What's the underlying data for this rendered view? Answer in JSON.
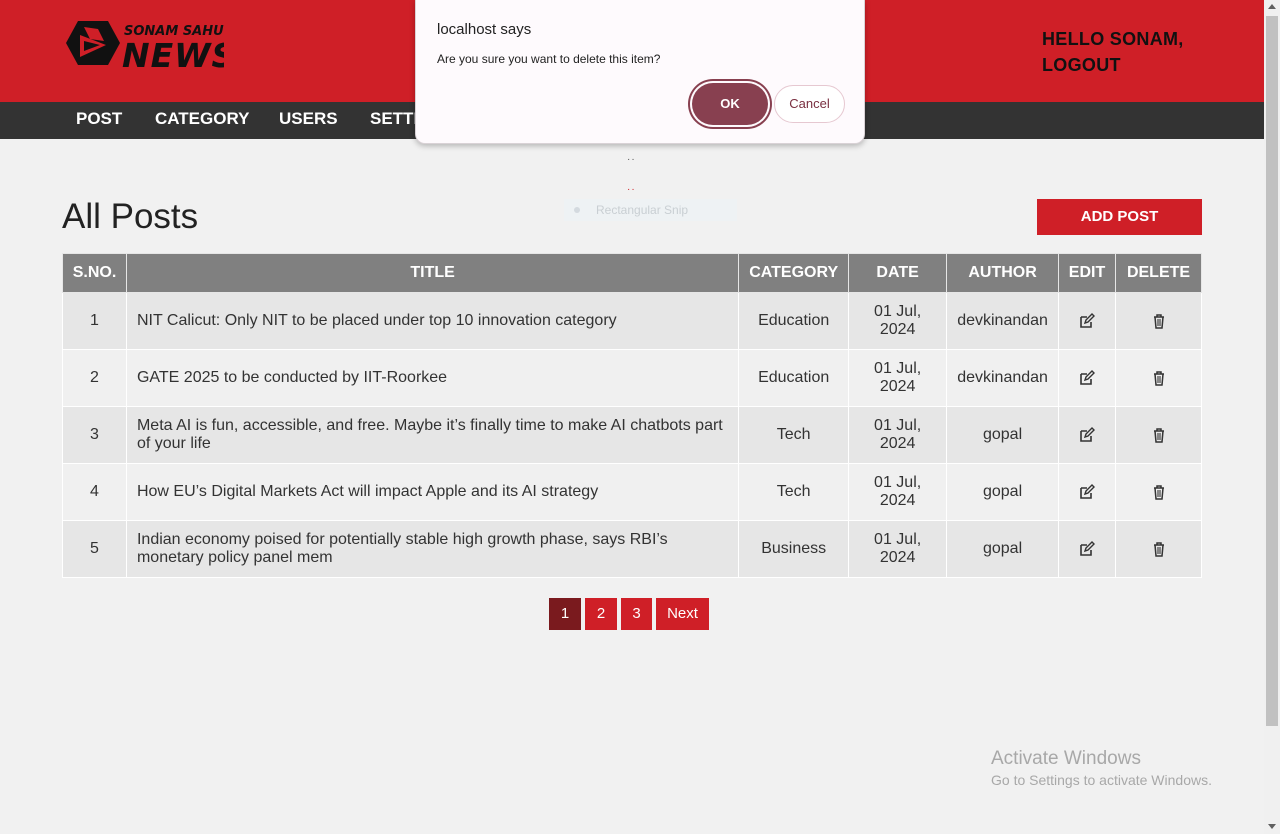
{
  "header": {
    "logo_small": "SONAM SAHU",
    "logo_big": "NEWS",
    "greeting": "HELLO SONAM,",
    "logout": "LOGOUT"
  },
  "nav": {
    "items": [
      "POST",
      "CATEGORY",
      "USERS",
      "SETTI"
    ]
  },
  "page": {
    "title": "All Posts",
    "add_button": "ADD POST"
  },
  "table": {
    "headers": [
      "S.NO.",
      "TITLE",
      "CATEGORY",
      "DATE",
      "AUTHOR",
      "EDIT",
      "DELETE"
    ],
    "rows": [
      {
        "sno": "1",
        "title": "NIT Calicut: Only NIT to be placed under top 10 innovation category",
        "category": "Education",
        "date": "01 Jul, 2024",
        "author": "devkinandan"
      },
      {
        "sno": "2",
        "title": "GATE 2025 to be conducted by IIT-Roorkee",
        "category": "Education",
        "date": "01 Jul, 2024",
        "author": "devkinandan"
      },
      {
        "sno": "3",
        "title": "Meta AI is fun, accessible, and free. Maybe it’s finally time to make AI chatbots part of your life",
        "category": "Tech",
        "date": "01 Jul, 2024",
        "author": "gopal"
      },
      {
        "sno": "4",
        "title": "How EU’s Digital Markets Act will impact Apple and its AI strategy",
        "category": "Tech",
        "date": "01 Jul, 2024",
        "author": "gopal"
      },
      {
        "sno": "5",
        "title": "Indian economy poised for potentially stable high growth phase, says RBI’s monetary policy panel mem",
        "category": "Business",
        "date": "01 Jul, 2024",
        "author": "gopal"
      }
    ]
  },
  "pagination": {
    "pages": [
      "1",
      "2",
      "3"
    ],
    "next": "Next",
    "current": "1"
  },
  "dialog": {
    "title": "localhost says",
    "message": "Are you sure you want to delete this item?",
    "ok": "OK",
    "cancel": "Cancel"
  },
  "snip": {
    "label": "Rectangular Snip"
  },
  "watermark": {
    "line1": "Activate Windows",
    "line2": "Go to Settings to activate Windows."
  },
  "colors": {
    "brand_red": "#cf1f27",
    "nav_dark": "#333333",
    "table_header": "#808080",
    "dialog_ok": "#884050"
  },
  "icons": {
    "edit": "edit-icon",
    "delete": "trash-icon",
    "logo": "play-logo-icon"
  }
}
